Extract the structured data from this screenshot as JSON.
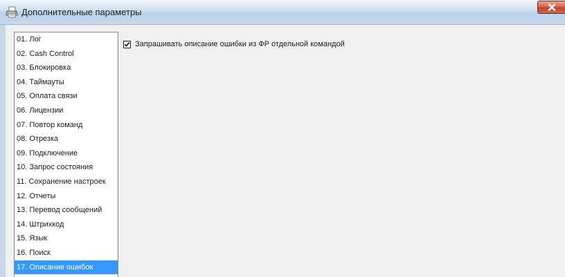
{
  "window": {
    "title": "Дополнительные параметры",
    "close_label": "×"
  },
  "nav": {
    "items": [
      {
        "label": "01. Лог"
      },
      {
        "label": "02. Cash Control"
      },
      {
        "label": "03. Блокировка"
      },
      {
        "label": "04. Таймауты"
      },
      {
        "label": "05. Оплата связи"
      },
      {
        "label": "06. Лицензии"
      },
      {
        "label": "07. Повтор команд"
      },
      {
        "label": "08. Отрезка"
      },
      {
        "label": "09. Подключение"
      },
      {
        "label": "10. Запрос состояния"
      },
      {
        "label": "11. Сохранение настроек"
      },
      {
        "label": "12. Отчеты"
      },
      {
        "label": "13. Перевод сообщений"
      },
      {
        "label": "14. Штрихкод"
      },
      {
        "label": "15. Язык"
      },
      {
        "label": "16. Поиск"
      },
      {
        "label": "17. Описание ошибок"
      }
    ],
    "selected_index": 16
  },
  "options": {
    "request_error_description": {
      "label": "Запрашивать описание ошибки из ФР отдельной командой",
      "checked": true
    }
  },
  "colors": {
    "selection": "#3399ff",
    "close_button": "#c2442a",
    "panel_background": "#f0f0f0"
  }
}
